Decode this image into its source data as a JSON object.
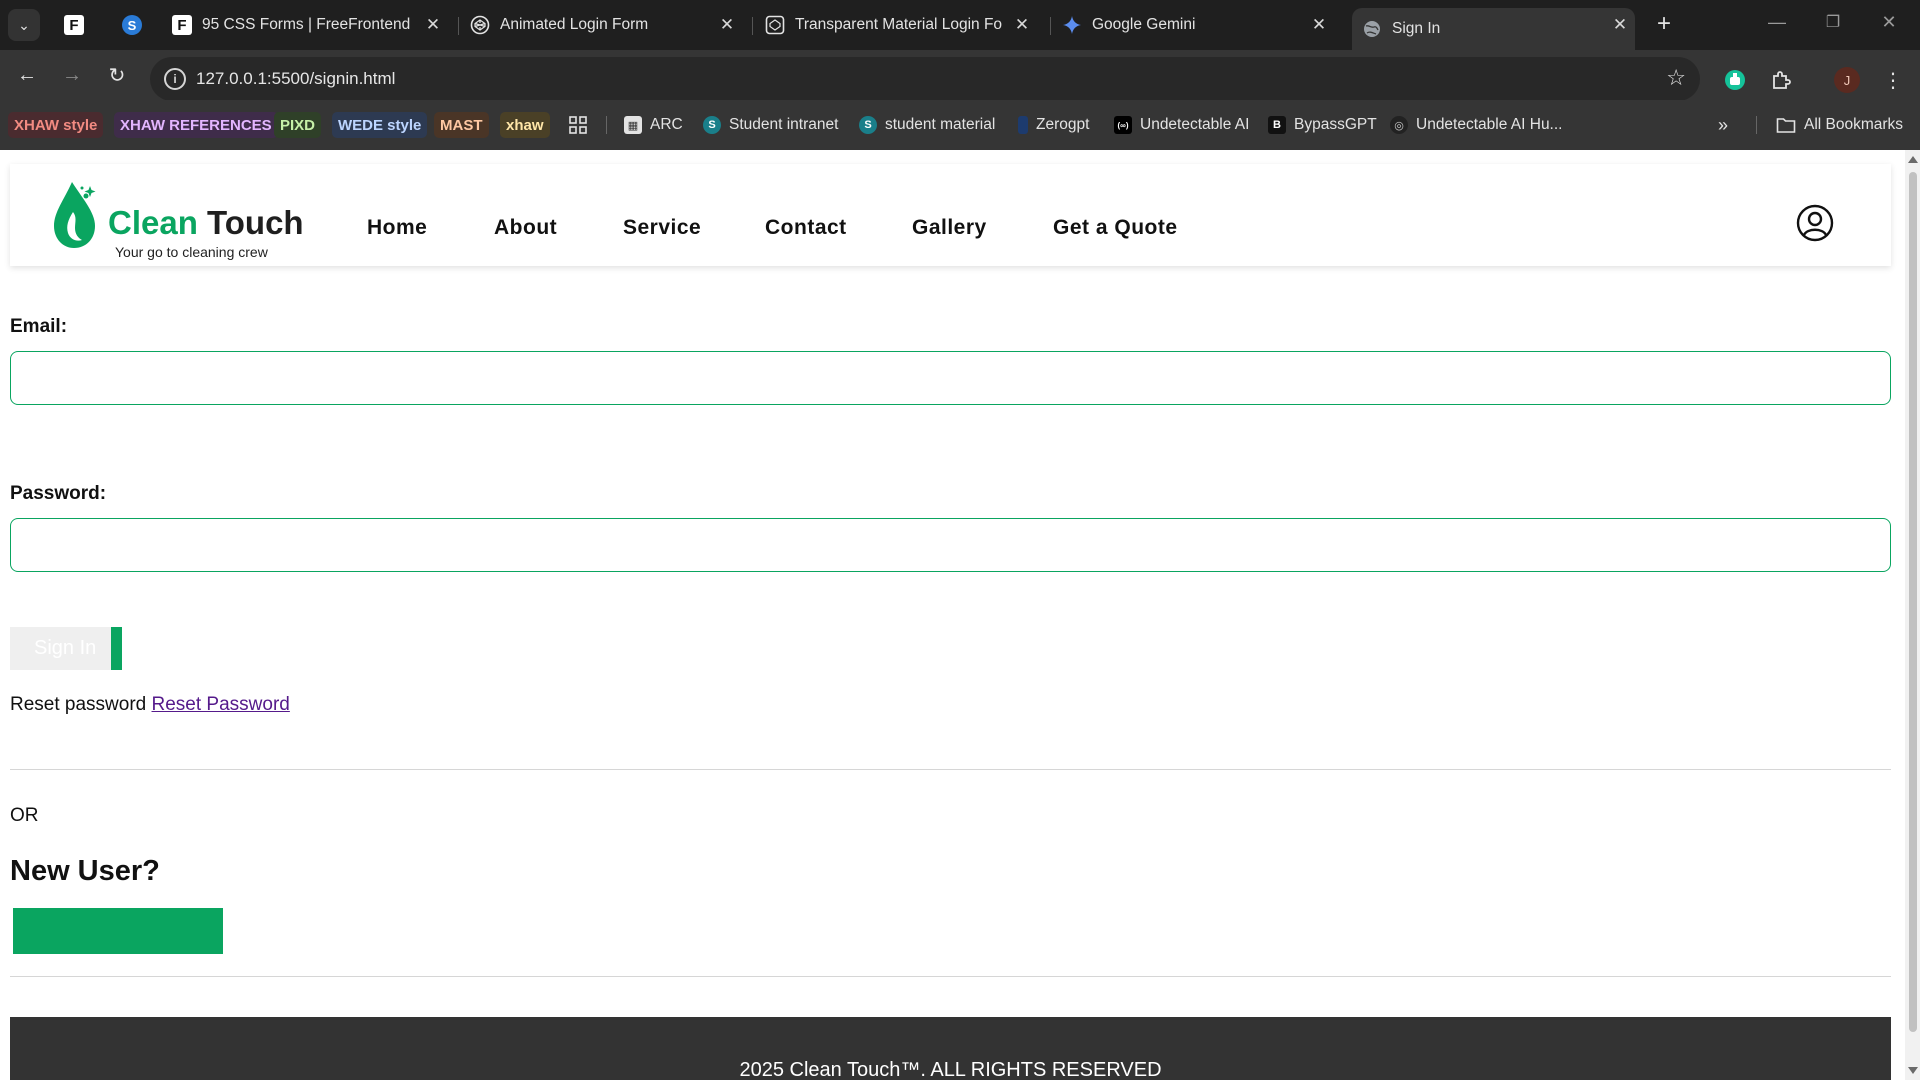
{
  "browser": {
    "tabs": [
      {
        "title": "95 CSS Forms | FreeFrontend"
      },
      {
        "title": "Animated Login Form"
      },
      {
        "title": "Transparent Material Login For"
      },
      {
        "title": "Google Gemini"
      },
      {
        "title": "Sign In"
      }
    ],
    "url": "127.0.0.1:5500/signin.html",
    "profile_initial": "J",
    "bookmarks": [
      {
        "label": "XHAW style",
        "color": "#f28b82",
        "bg": "#4a2b2f"
      },
      {
        "label": "XHAW REFERENCES",
        "color": "#e3b6ff",
        "bg": "#3f2c4a"
      },
      {
        "label": "PIXD",
        "color": "#c6f0a8",
        "bg": "#2f4028"
      },
      {
        "label": "WEDE style",
        "color": "#bcd5ff",
        "bg": "#2d3a52"
      },
      {
        "label": "MAST",
        "color": "#ffc9a3",
        "bg": "#4a3526"
      },
      {
        "label": "xhaw",
        "color": "#ffe6a8",
        "bg": "#4a4026"
      }
    ],
    "bookmark_links": [
      {
        "label": "ARC"
      },
      {
        "label": "Student intranet"
      },
      {
        "label": "student material"
      },
      {
        "label": "Zerogpt"
      },
      {
        "label": "Undetectable AI"
      },
      {
        "label": "BypassGPT"
      },
      {
        "label": "Undetectable AI Hu..."
      }
    ],
    "all_bookmarks": "All Bookmarks"
  },
  "site": {
    "brand_green": "Clean",
    "brand_dark": "Touch",
    "tagline": "Your go to cleaning crew",
    "nav": [
      "Home",
      "About",
      "Service",
      "Contact",
      "Gallery",
      "Get a Quote"
    ],
    "accent_color": "#0aa560"
  },
  "form": {
    "email_label": "Email:",
    "email_value": "",
    "password_label": "Password:",
    "password_value": "",
    "signin_label": "Sign In",
    "reset_text": "Reset password",
    "reset_link": "Reset Password",
    "or_text": "OR",
    "new_user_heading": "New User?",
    "register_label": ""
  },
  "footer": {
    "text": "2025 Clean Touch™. ALL RIGHTS RESERVED"
  }
}
